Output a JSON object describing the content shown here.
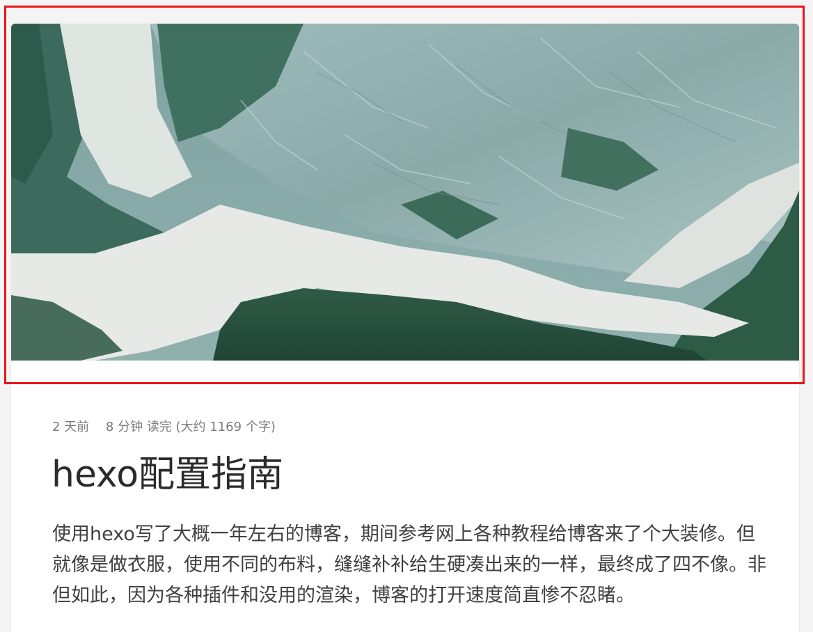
{
  "post": {
    "date": "2 天前",
    "read_time": "8 分钟 读完 (大约 1169 个字)",
    "title": "hexo配置指南",
    "excerpt": "使用hexo写了大概一年左右的博客，期间参考网上各种教程给博客来了个大装修。但就像是做衣服，使用不同的布料，缝缝补补给生硬凑出来的一样，最终成了四不像。非但如此，因为各种插件和没用的渲染，博客的打开速度简直惨不忍睹。"
  },
  "colors": {
    "highlight_box": "#e8141b",
    "meta_text": "#7a7a7a",
    "title_text": "#2b2b2b",
    "body_text": "#404040"
  }
}
